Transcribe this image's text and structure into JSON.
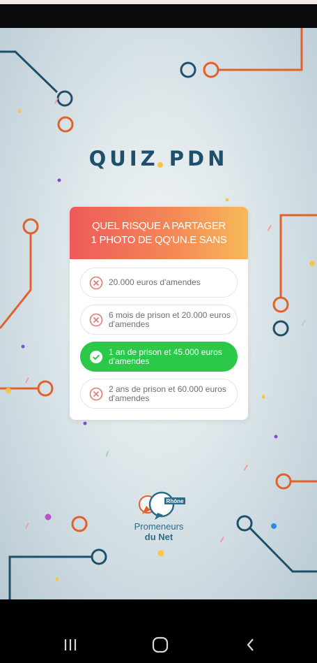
{
  "quiz": {
    "title": "QUIZ PDN",
    "question_line1": "QUEL RISQUE A PARTAGER",
    "question_line2": "1 PHOTO DE QQ'UN.E SANS",
    "answers": [
      {
        "text": "20.000 euros d'amendes",
        "status": "wrong"
      },
      {
        "text": "6 mois de prison et 20.000 euros d'amendes",
        "status": "wrong"
      },
      {
        "text": "1 an de prison et 45.000 euros d'amendes",
        "status": "correct"
      },
      {
        "text": "2 ans de prison et 60.000 euros d'amendes",
        "status": "wrong"
      }
    ]
  },
  "logo": {
    "badge": "Rhône",
    "line1": "Promeneurs",
    "line2": "du Net"
  },
  "colors": {
    "title": "#1e4f6b",
    "correct": "#2cc84a",
    "wrong_icon": "#e07a7a",
    "circuit_blue": "#1e4f6b",
    "circuit_orange": "#e2602c"
  },
  "icons": {
    "wrong": "x-circle-icon",
    "correct": "check-circle-icon",
    "nav_recents": "recents-icon",
    "nav_home": "home-icon",
    "nav_back": "back-icon"
  }
}
